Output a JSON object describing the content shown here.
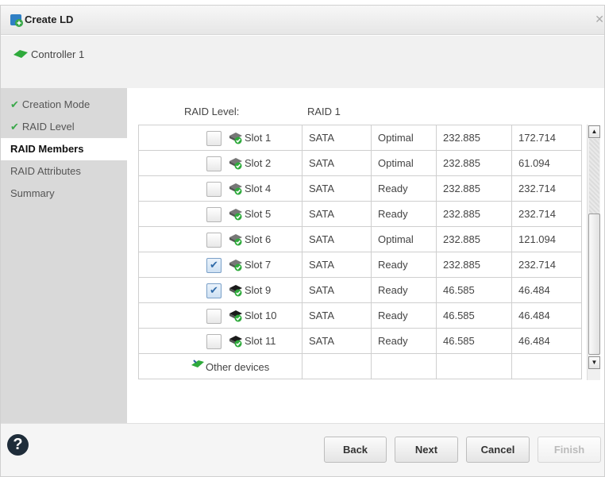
{
  "dialog": {
    "title": "Create LD",
    "controller": "Controller 1"
  },
  "sidebar": {
    "items": [
      {
        "label": "Creation Mode",
        "done": true
      },
      {
        "label": "RAID Level",
        "done": true
      },
      {
        "label": "RAID Members",
        "active": true
      },
      {
        "label": "RAID Attributes"
      },
      {
        "label": "Summary"
      }
    ]
  },
  "raid": {
    "label": "RAID Level:",
    "value": "RAID 1"
  },
  "rows": [
    {
      "slot": "Slot 1",
      "type": "SATA",
      "state": "Optimal",
      "size": "232.885",
      "free": "172.714",
      "checked": false,
      "disk": "partial-disk-icon"
    },
    {
      "slot": "Slot 2",
      "type": "SATA",
      "state": "Optimal",
      "size": "232.885",
      "free": "61.094",
      "checked": false,
      "disk": "partial-disk-icon"
    },
    {
      "slot": "Slot 4",
      "type": "SATA",
      "state": "Ready",
      "size": "232.885",
      "free": "232.714",
      "checked": false,
      "disk": "partial-disk-icon"
    },
    {
      "slot": "Slot 5",
      "type": "SATA",
      "state": "Ready",
      "size": "232.885",
      "free": "232.714",
      "checked": false,
      "disk": "partial-disk-icon"
    },
    {
      "slot": "Slot 6",
      "type": "SATA",
      "state": "Optimal",
      "size": "232.885",
      "free": "121.094",
      "checked": false,
      "disk": "partial-disk-icon"
    },
    {
      "slot": "Slot 7",
      "type": "SATA",
      "state": "Ready",
      "size": "232.885",
      "free": "232.714",
      "checked": true,
      "disk": "partial-disk-icon"
    },
    {
      "slot": "Slot 9",
      "type": "SATA",
      "state": "Ready",
      "size": "46.585",
      "free": "46.484",
      "checked": true,
      "disk": "black-disk-icon"
    },
    {
      "slot": "Slot 10",
      "type": "SATA",
      "state": "Ready",
      "size": "46.585",
      "free": "46.484",
      "checked": false,
      "disk": "black-disk-icon"
    },
    {
      "slot": "Slot 11",
      "type": "SATA",
      "state": "Ready",
      "size": "46.585",
      "free": "46.484",
      "checked": false,
      "disk": "black-disk-icon"
    }
  ],
  "other_devices": "Other devices",
  "buttons": {
    "back": "Back",
    "next": "Next",
    "cancel": "Cancel",
    "finish": "Finish"
  },
  "colors": {
    "check": "#3aa84a",
    "disk_green": "#2faa3c",
    "sidebar_bg": "#d9d9d9"
  }
}
